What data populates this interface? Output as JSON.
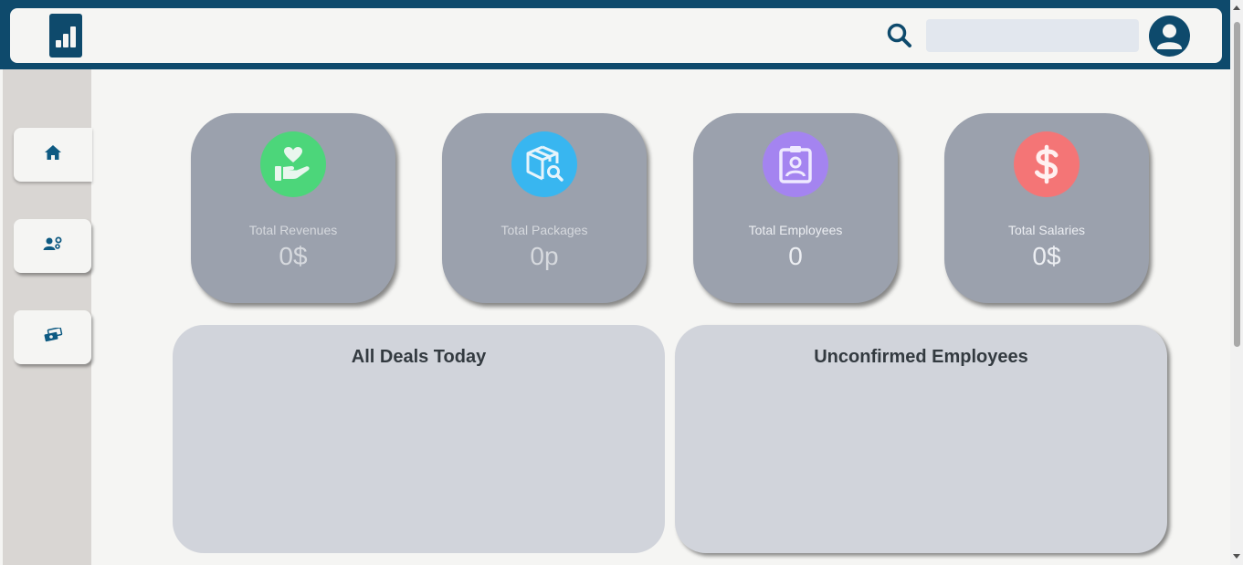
{
  "header": {
    "logo_icon": "bar-chart-icon",
    "search_icon": "search-icon",
    "search_value": "",
    "search_placeholder": "",
    "avatar_icon": "user-avatar-icon",
    "brand_color": "#0e4a6c"
  },
  "sidebar": {
    "items": [
      {
        "icon": "home-icon",
        "active": true
      },
      {
        "icon": "users-settings-icon",
        "active": false
      },
      {
        "icon": "money-stack-icon",
        "active": false
      }
    ]
  },
  "stats": [
    {
      "label": "Total Revenues",
      "value": "0$",
      "icon": "hand-heart-icon",
      "color": "#4cd67a"
    },
    {
      "label": "Total Packages",
      "value": "0p",
      "icon": "package-search-icon",
      "color": "#38b6f0"
    },
    {
      "label": "Total Employees",
      "value": "0",
      "icon": "id-badge-icon",
      "color": "#a484f0"
    },
    {
      "label": "Total Salaries",
      "value": "0$",
      "icon": "dollar-icon",
      "color": "#f47576"
    }
  ],
  "panels": [
    {
      "title": "All Deals Today"
    },
    {
      "title": "Unconfirmed Employees"
    }
  ]
}
